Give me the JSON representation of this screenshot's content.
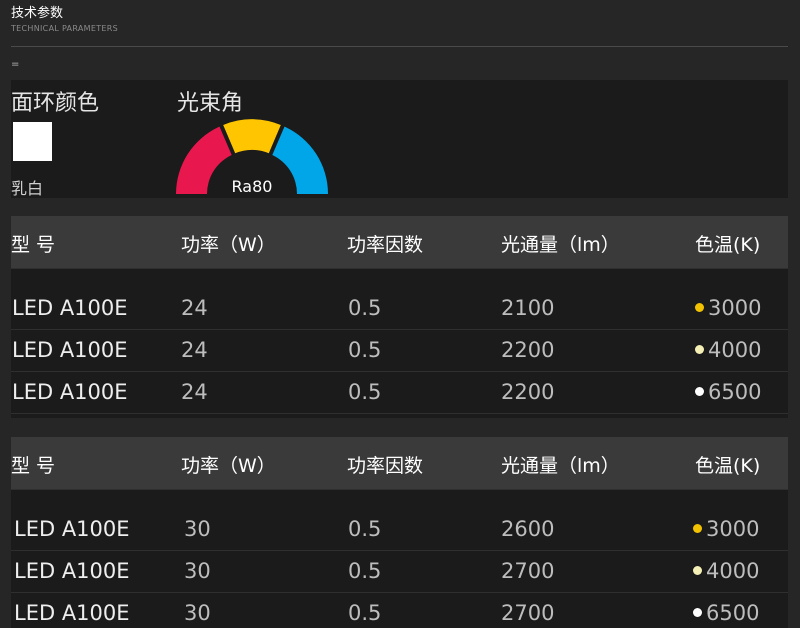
{
  "header": {
    "title": "技术参数",
    "subtitle": "TECHNICAL PARAMETERS"
  },
  "separator_text": "=",
  "surface": {
    "label": "面环颜色",
    "swatch_color": "#ffffff",
    "swatch_name": "乳白"
  },
  "beam": {
    "label": "光束角",
    "ra": "Ra80",
    "segment_colors": [
      "#e8174d",
      "#ffc600",
      "#00a6e8"
    ]
  },
  "tables": [
    {
      "headers": [
        "型  号",
        "功率（W）",
        "功率因数",
        "光通量（lm）",
        "色温(K)"
      ],
      "rows": [
        {
          "model": "LED A100E",
          "power": "24",
          "pf": "0.5",
          "flux": "2100",
          "cct": "3000",
          "dot_color": "#f2c200"
        },
        {
          "model": "LED A100E",
          "power": "24",
          "pf": "0.5",
          "flux": "2200",
          "cct": "4000",
          "dot_color": "#f4efb4"
        },
        {
          "model": "LED A100E",
          "power": "24",
          "pf": "0.5",
          "flux": "2200",
          "cct": "6500",
          "dot_color": "#ffffff"
        }
      ]
    },
    {
      "headers": [
        "型  号",
        "功率（W）",
        "功率因数",
        "光通量（lm）",
        "色温(K)"
      ],
      "rows": [
        {
          "model": "LED A100E",
          "power": "30",
          "pf": "0.5",
          "flux": "2600",
          "cct": "3000",
          "dot_color": "#f2c200"
        },
        {
          "model": "LED A100E",
          "power": "30",
          "pf": "0.5",
          "flux": "2700",
          "cct": "4000",
          "dot_color": "#f4efb4"
        },
        {
          "model": "LED A100E",
          "power": "30",
          "pf": "0.5",
          "flux": "2700",
          "cct": "6500",
          "dot_color": "#ffffff"
        }
      ]
    }
  ]
}
